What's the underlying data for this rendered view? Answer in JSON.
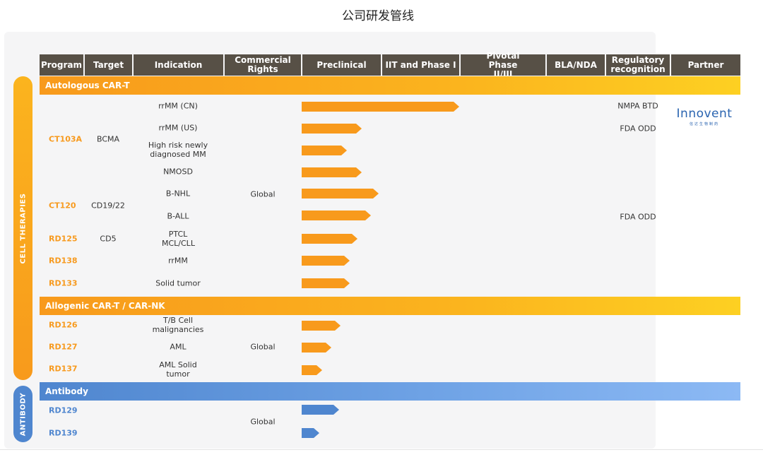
{
  "title": "公司研发管线",
  "headers": [
    "Program",
    "Target",
    "Indication",
    "Commercial Rights",
    "Preclinical",
    "IIT and Phase I",
    "Pivotal Phase II/III",
    "BLA/NDA",
    "Regulatory recognition",
    "Partner"
  ],
  "side_labels": {
    "cell_therapies": "CELL THERAPIES",
    "antibody": "ANTIBODY"
  },
  "sections": {
    "autologous": "Autologous CAR-T",
    "allogenic": "Allogenic CAR-T / CAR-NK",
    "antibody": "Antibody"
  },
  "programs": [
    "CT103A",
    "CT120",
    "RD125",
    "RD138",
    "RD133",
    "RD126",
    "RD127",
    "RD137",
    "RD129",
    "RD139"
  ],
  "targets": [
    "BCMA",
    "CD19/22",
    "CD5"
  ],
  "indications": [
    "rrMM (CN)",
    "rrMM (US)",
    "High risk newly diagnosed MM",
    "NMOSD",
    "B-NHL",
    "B-ALL",
    "PTCL MCL/CLL",
    "rrMM",
    "Solid tumor",
    "T/B Cell malignancies",
    "AML",
    "AML Solid tumor",
    "",
    ""
  ],
  "rights": {
    "autologous": "Global",
    "allogenic": "Global",
    "antibody": "Global"
  },
  "regulatory": {
    "nmpa_btd": "NMPA BTD",
    "fda_odd_us": "FDA ODD",
    "fda_odd_ball": "FDA ODD"
  },
  "partner": {
    "name": "Innovent",
    "sub": "信达生物制药"
  },
  "progress": [
    0.5,
    0.18,
    0.13,
    0.18,
    0.235,
    0.21,
    0.165,
    0.14,
    0.14,
    0.11,
    0.08,
    0.05,
    0.105,
    0.04
  ],
  "colors": {
    "header": "#575046",
    "orange": "#f89a1c",
    "blue": "#4f86cf",
    "program_orange": "#f79a1e"
  }
}
